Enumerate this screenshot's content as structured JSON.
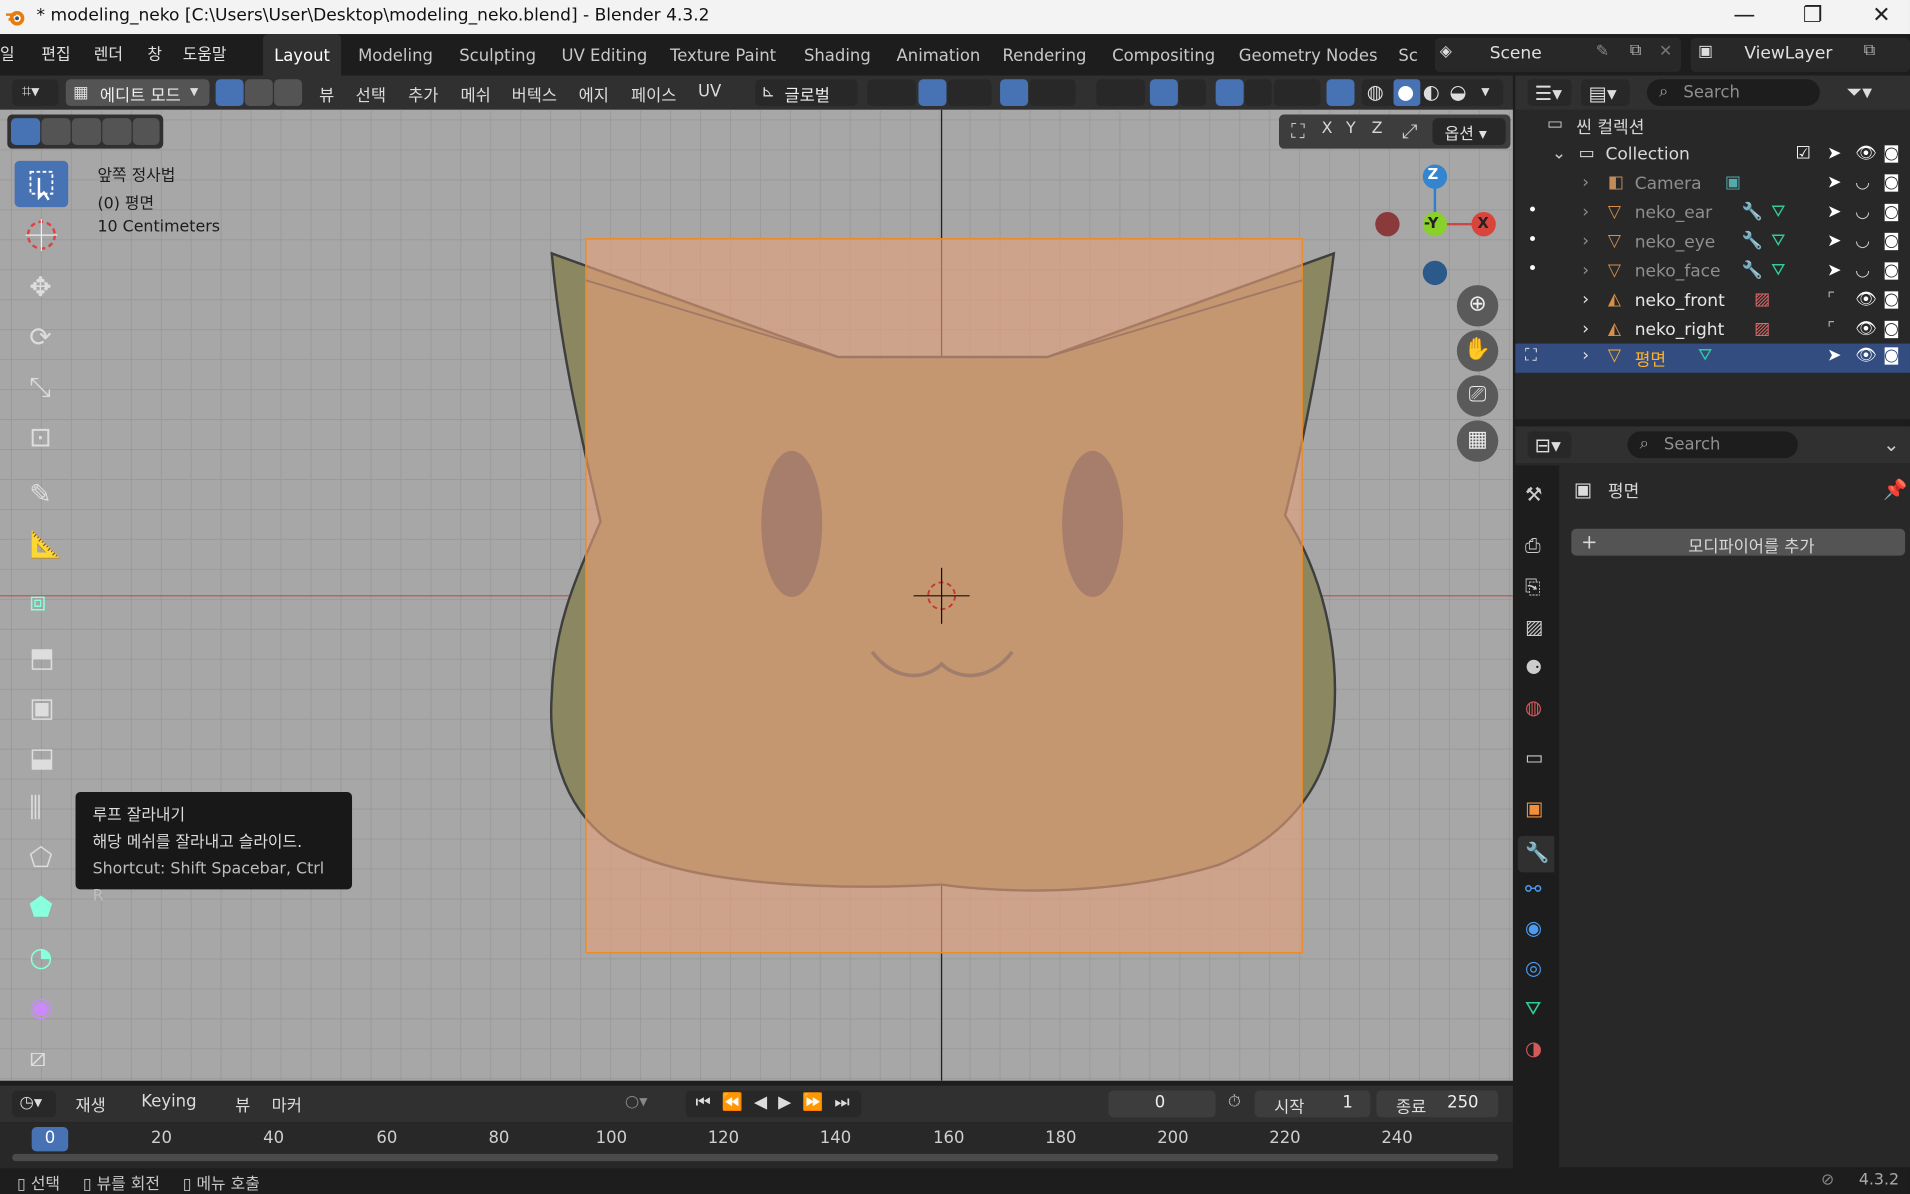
{
  "window": {
    "title": "* modeling_neko [C:\\Users\\User\\Desktop\\modeling_neko.blend] - Blender 4.3.2"
  },
  "menu": [
    "일",
    "편집",
    "렌더",
    "창",
    "도움말"
  ],
  "workspaces": [
    "Layout",
    "Modeling",
    "Sculpting",
    "UV Editing",
    "Texture Paint",
    "Shading",
    "Animation",
    "Rendering",
    "Compositing",
    "Geometry Nodes",
    "Sc"
  ],
  "scene": {
    "name": "Scene",
    "view_layer": "ViewLayer"
  },
  "viewport_header": {
    "mode": "에디트 모드",
    "menus": [
      "뷰",
      "선택",
      "추가",
      "메쉬",
      "버텍스",
      "에지",
      "페이스",
      "UV"
    ],
    "transform": "글로벌",
    "options": "옵션",
    "axes": [
      "X",
      "Y",
      "Z"
    ]
  },
  "overlay": {
    "view": "앞쪽 정사법",
    "object": "(0) 평면",
    "scale": "10 Centimeters"
  },
  "gizmo": {
    "z": "Z",
    "y": "-Y",
    "x": "X"
  },
  "tooltip": {
    "title": "루프 잘라내기",
    "desc": "해당 메쉬를 잘라내고 슬라이드.",
    "shortcut": "Shortcut: Shift Spacebar, Ctrl R"
  },
  "outliner": {
    "search": "Search",
    "root": "씬 컬렉션",
    "collection": "Collection",
    "items": [
      "Camera",
      "neko_ear",
      "neko_eye",
      "neko_face",
      "neko_front",
      "neko_right",
      "평면"
    ]
  },
  "properties": {
    "search": "Search",
    "object": "평면",
    "add_modifier": "모디파이어를 추가"
  },
  "timeline": {
    "playback": "재생",
    "keying": "Keying",
    "view": "뷰",
    "marker": "마커",
    "current": "0",
    "start_label": "시작",
    "start": "1",
    "end_label": "종료",
    "end": "250",
    "ticks": [
      "0",
      "20",
      "40",
      "60",
      "80",
      "100",
      "120",
      "140",
      "160",
      "180",
      "200",
      "220",
      "240"
    ]
  },
  "status": {
    "select": "선택",
    "rotate": "뷰를 회전",
    "menu": "메뉴 호출",
    "version": "4.3.2"
  },
  "colors": {
    "accent": "#4772b3",
    "selected_text": "#ffaf29",
    "plane": "#f0b070"
  }
}
